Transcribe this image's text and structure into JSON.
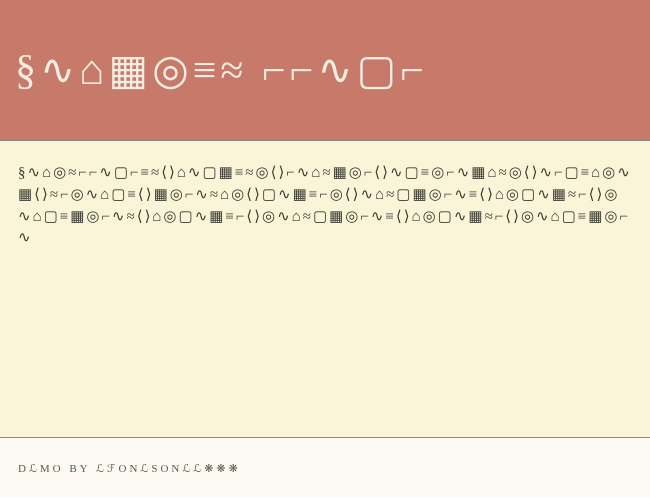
{
  "header": {
    "title_glyphs": "§∿⌂▦◎≡≈ ⌐⌐∿▢⌐"
  },
  "main": {
    "sample_text": "§∿⌂◎≈⌐⌐∿▢⌐≡≈⟨⟩⌂∿▢▦≡≈◎⟨⟩⌐∿⌂≈▦◎⌐⟨⟩∿▢≡◎⌐∿▦⌂≈◎⟨⟩∿⌐▢≡⌂◎∿▦⟨⟩≈⌐◎∿⌂▢≡⟨⟩▦◎⌐∿≈⌂◎⟨⟩▢∿▦≡⌐◎⟨⟩∿⌂≈▢▦◎⌐∿≡⟨⟩⌂◎▢∿▦≈⌐⟨⟩◎∿⌂▢≡▦◎⌐∿≈⟨⟩⌂◎▢∿▦≡⌐⟨⟩◎∿⌂≈▢▦◎⌐∿≡⟨⟩⌂◎▢∿▦≈⌐⟨⟩◎∿⌂▢≡▦◎⌐∿"
  },
  "footer": {
    "credit": "DℒMO BY ℒℱONℒSONℒℒ❋❋❋"
  }
}
